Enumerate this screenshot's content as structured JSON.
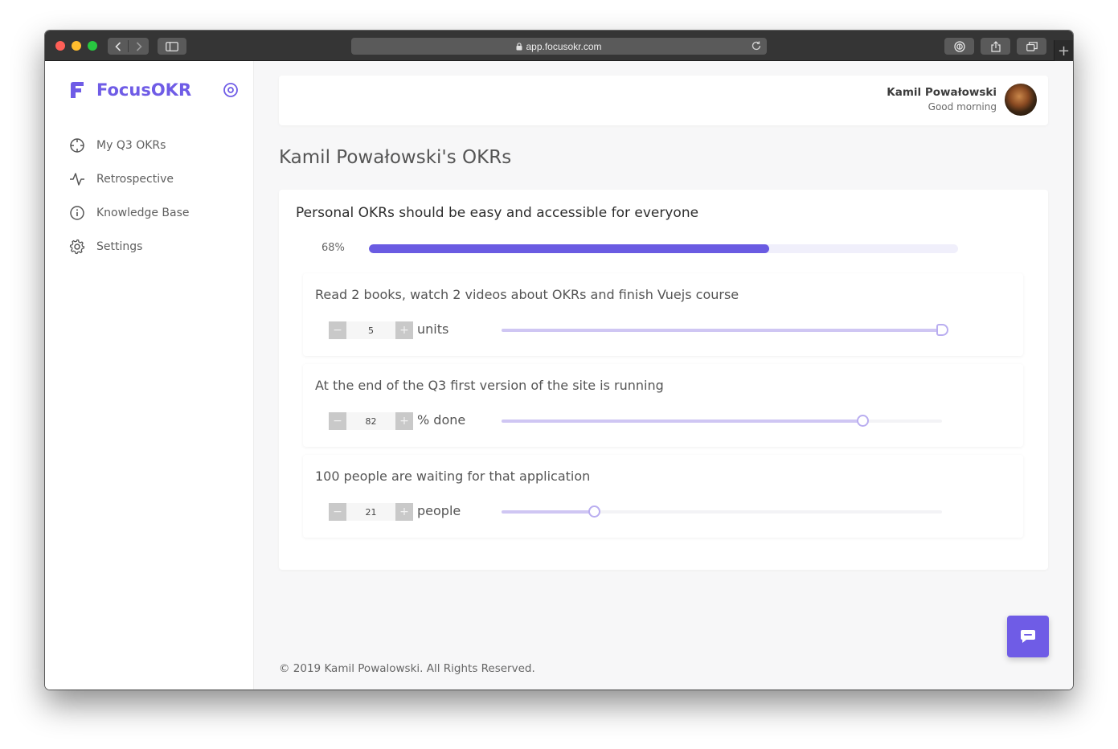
{
  "browser": {
    "url": "app.focusokr.com"
  },
  "sidebar": {
    "brand": "FocusOKR",
    "items": [
      {
        "label": "My Q3 OKRs",
        "icon": "crosshair-icon"
      },
      {
        "label": "Retrospective",
        "icon": "activity-icon"
      },
      {
        "label": "Knowledge Base",
        "icon": "info-icon"
      },
      {
        "label": "Settings",
        "icon": "gear-icon"
      }
    ]
  },
  "header": {
    "user_name": "Kamil Powałowski",
    "greeting": "Good morning"
  },
  "page": {
    "title": "Kamil Powałowski's OKRs"
  },
  "objective": {
    "title": "Personal OKRs should be easy and accessible for everyone",
    "progress_label": "68%",
    "progress": 0.68,
    "key_results": [
      {
        "title": "Read 2 books, watch 2 videos about OKRs and finish Vuejs course",
        "value": "5",
        "unit": "units",
        "progress": 1.0
      },
      {
        "title": "At the end of the Q3 first version of the site is running",
        "value": "82",
        "unit": "% done",
        "progress": 0.82
      },
      {
        "title": "100 people are waiting for that application",
        "value": "21",
        "unit": "people",
        "progress": 0.21
      }
    ]
  },
  "stepper": {
    "minus": "−",
    "plus": "+"
  },
  "footer": {
    "text": "© 2019 Kamil Powalowski. All Rights Reserved."
  },
  "colors": {
    "accent": "#6f5ce6",
    "progress": "#6a5be2",
    "slider_fill": "#cfc6f3"
  }
}
